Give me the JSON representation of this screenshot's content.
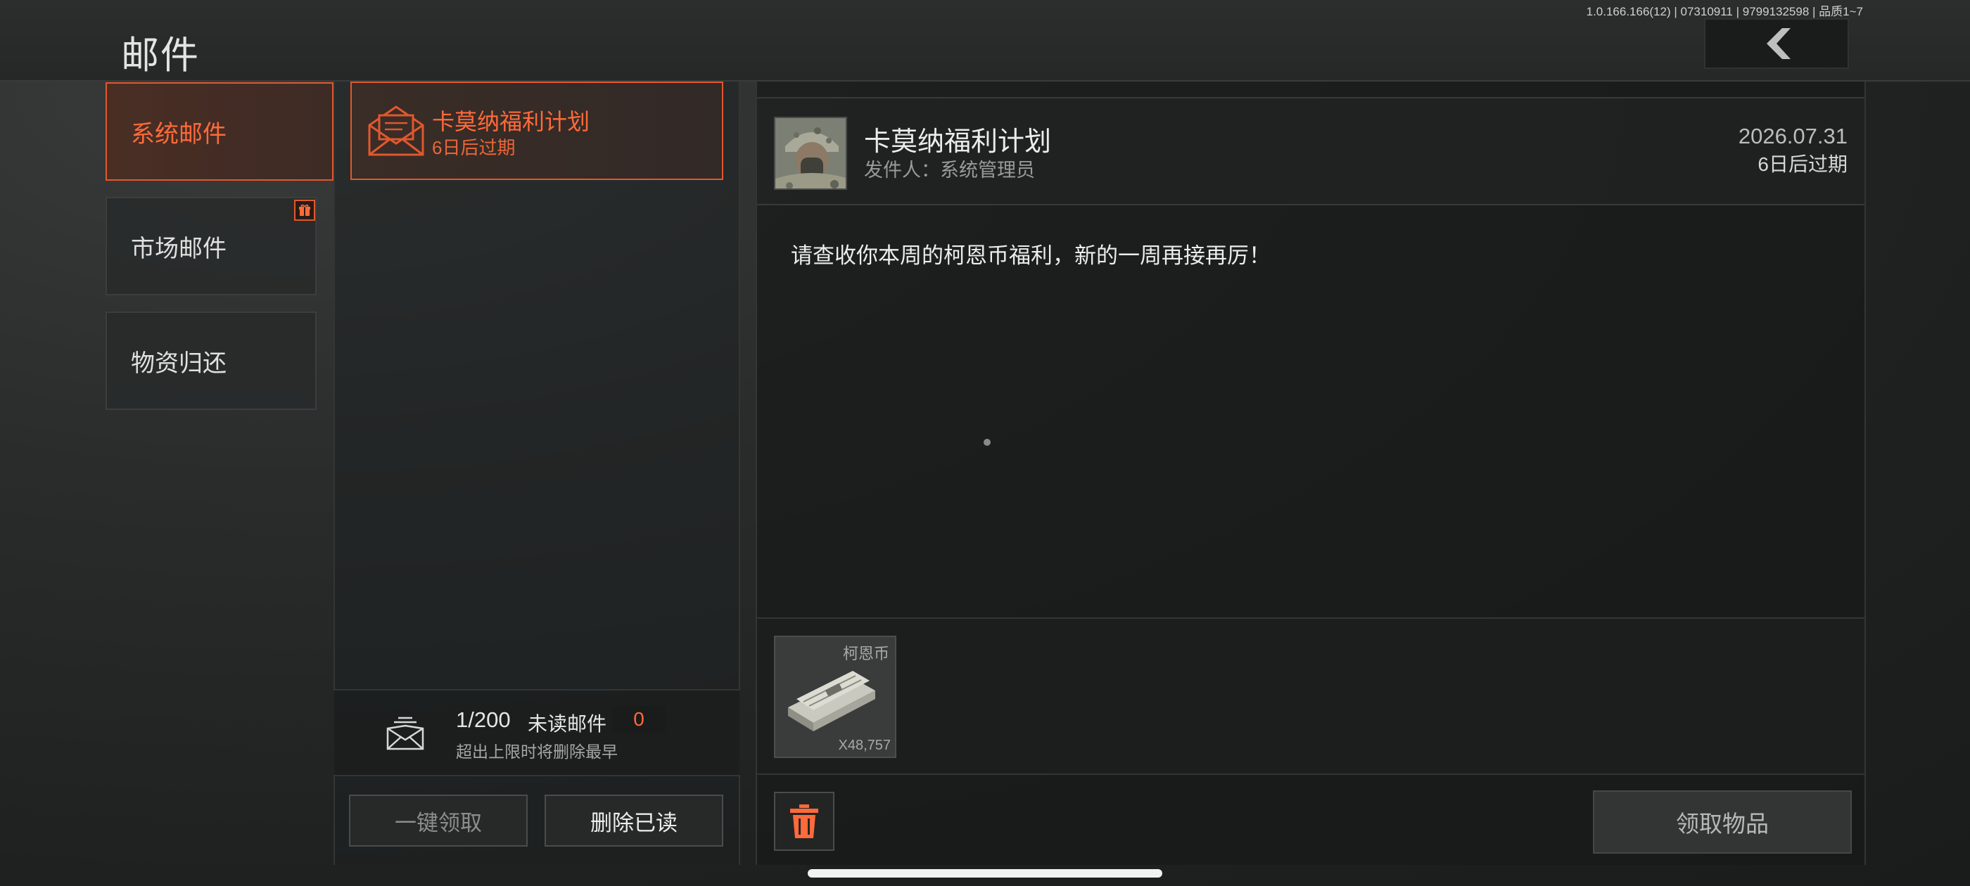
{
  "header": {
    "title": "邮件",
    "build_info": "1.0.166.166(12) | 07310911 | 9799132598 | 品质1~7",
    "back_icon": "chevron-left-icon"
  },
  "categories": [
    {
      "label": "系统邮件",
      "active": true
    },
    {
      "label": "市场邮件",
      "active": false,
      "badge_icon": "gift-icon"
    },
    {
      "label": "物资归还",
      "active": false
    }
  ],
  "mail_list": {
    "items": [
      {
        "title": "卡莫纳福利计划",
        "expiry": "6日后过期",
        "icon": "open-envelope-icon"
      }
    ],
    "stats": {
      "count": "1/200",
      "unread_label": "未读邮件",
      "unread_count": "0",
      "note": "超出上限时将删除最早"
    },
    "claim_all_label": "一键领取",
    "delete_read_label": "删除已读"
  },
  "detail": {
    "title": "卡莫纳福利计划",
    "sender_label": "发件人：系统管理员",
    "date": "2026.07.31",
    "expiry": "6日后过期",
    "body": "请查收你本周的柯恩币福利，新的一周再接再厉！",
    "attachment": {
      "name": "柯恩币",
      "quantity": "X48,757",
      "icon": "money-stack-icon"
    },
    "collect_label": "领取物品",
    "delete_icon": "trash-icon"
  },
  "colors": {
    "accent": "#e0582e",
    "accent_text": "#ff6a3a",
    "background": "#222424"
  }
}
